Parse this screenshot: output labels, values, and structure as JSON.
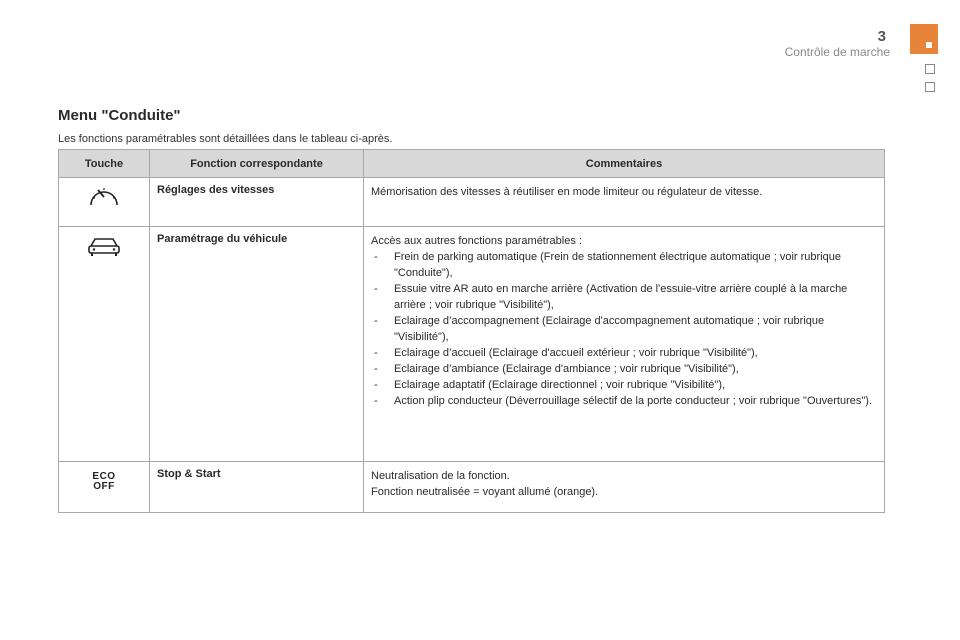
{
  "header": {
    "page_number": "3",
    "section": "Contrôle de marche"
  },
  "heading": "Menu \"Conduite\"",
  "intro": "Les fonctions paramétrables sont détaillées dans le tableau ci-après.",
  "table": {
    "headers": [
      "Touche",
      "Fonction correspondante",
      "Commentaires"
    ],
    "rows": [
      {
        "icon": "speedometer-icon",
        "function": "Réglages des vitesses",
        "comment": "Mémorisation des vitesses à réutiliser en mode limiteur ou régulateur de vitesse."
      },
      {
        "icon": "car-icon",
        "function": "Paramétrage du véhicule",
        "comment_intro": "Accès aux autres fonctions paramétrables :",
        "items": [
          "Frein de parking automatique (Frein de stationnement électrique automatique ; voir rubrique \"Conduite\"),",
          "Essuie vitre AR auto en marche arrière (Activation de l'essuie-vitre arrière couplé à la marche arrière ; voir rubrique \"Visibilité\"),",
          "Eclairage d’accompagnement (Eclairage d'accompagnement automatique ; voir rubrique \"Visibilité\"),",
          "Eclairage d’accueil (Eclairage d'accueil extérieur ; voir rubrique \"Visibilité\"),",
          "Eclairage d’ambiance (Eclairage d'ambiance ; voir rubrique \"Visibilité\"),",
          "Eclairage adaptatif (Eclairage directionnel ; voir rubrique \"Visibilité\"),",
          "Action plip conducteur (Déverrouillage sélectif de la porte conducteur ; voir rubrique \"Ouvertures\")."
        ]
      },
      {
        "icon": "eco-off-icon",
        "icon_text_top": "ECO",
        "icon_text_bottom": "OFF",
        "function": "Stop & Start",
        "comment_lines": [
          "Neutralisation de la fonction.",
          "Fonction neutralisée = voyant allumé (orange)."
        ]
      }
    ]
  },
  "colors": {
    "accent": "#e8833a",
    "header_bg": "#d8d8d8",
    "border": "#a8a8a8"
  }
}
